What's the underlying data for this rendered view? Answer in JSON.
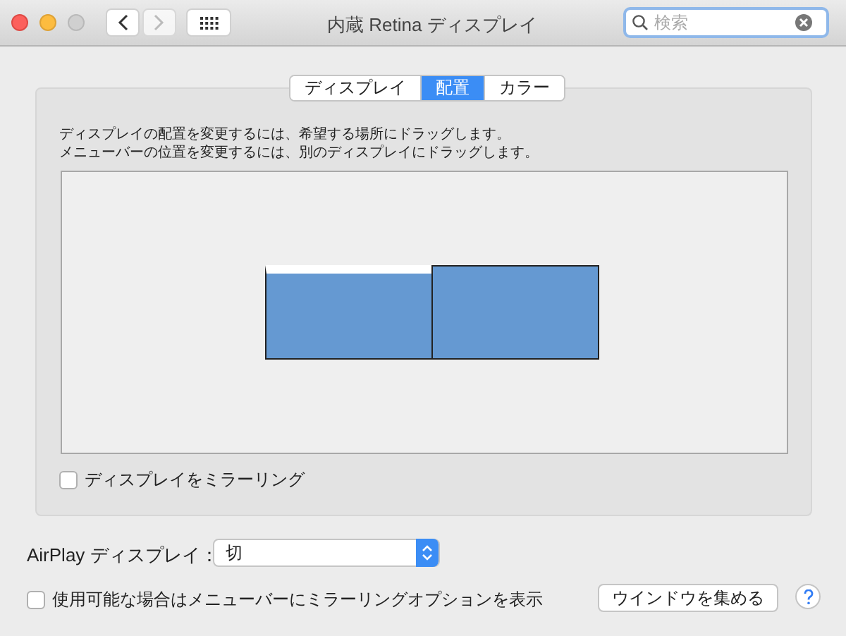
{
  "window": {
    "title": "内蔵 Retina ディスプレイ"
  },
  "search": {
    "placeholder": "検索"
  },
  "tabs": [
    {
      "label": "ディスプレイ",
      "selected": false
    },
    {
      "label": "配置",
      "selected": true
    },
    {
      "label": "カラー",
      "selected": false
    }
  ],
  "instructions": [
    "ディスプレイの配置を変更するには、希望する場所にドラッグします。",
    "メニューバーの位置を変更するには、別のディスプレイにドラッグします。"
  ],
  "displays": [
    {
      "menu_bar": true
    },
    {
      "menu_bar": false
    }
  ],
  "mirror": {
    "label": "ディスプレイをミラーリング",
    "checked": false
  },
  "airplay": {
    "label": "AirPlay ディスプレイ：",
    "value": "切"
  },
  "show_in_menu": {
    "label": "使用可能な場合はメニューバーにミラーリングオプションを表示",
    "checked": false
  },
  "gather_button": "ウインドウを集める"
}
